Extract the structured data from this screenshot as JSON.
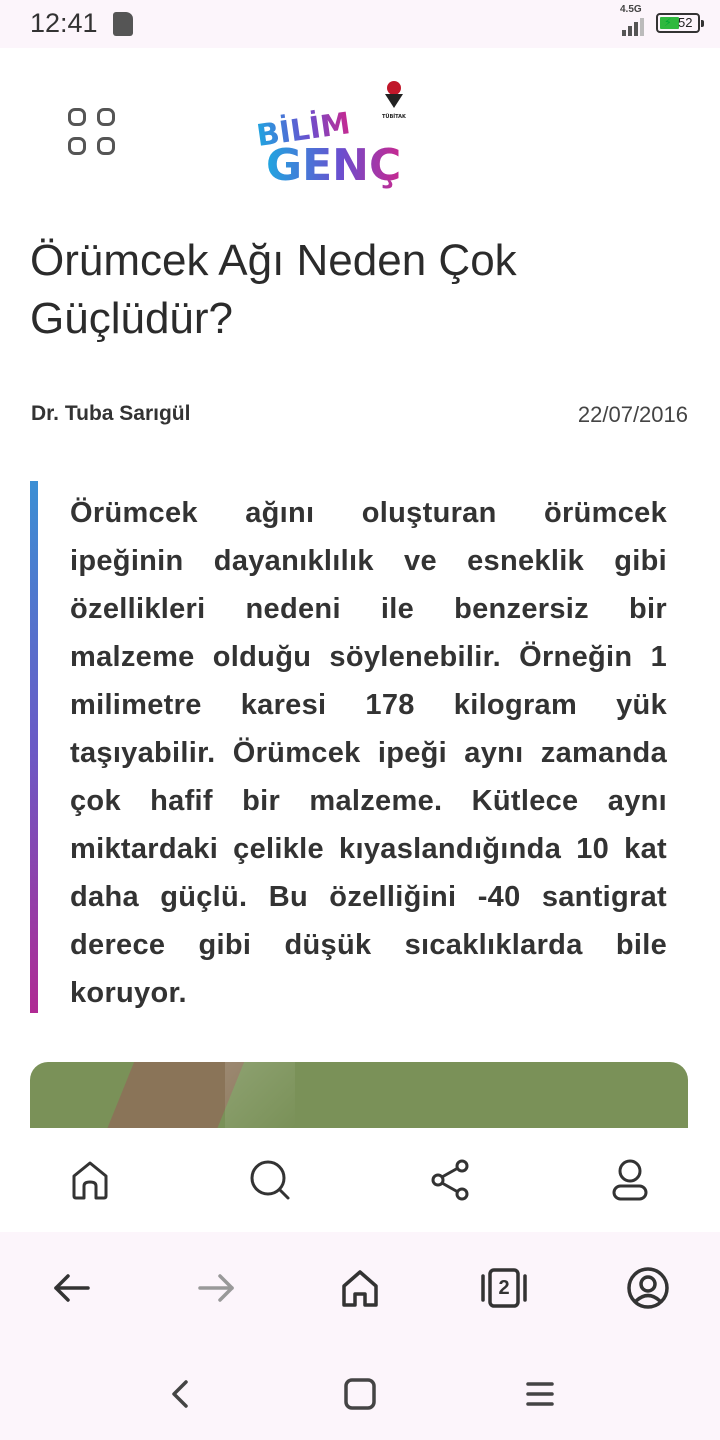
{
  "status_bar": {
    "time": "12:41",
    "network": "4.5G",
    "battery": "52"
  },
  "header": {
    "logo_line1": "BİLİM",
    "logo_line2": "GENÇ",
    "logo_badge": "TÜBİTAK"
  },
  "article": {
    "title": "Örümcek Ağı Neden Çok Güçlüdür?",
    "author": "Dr. Tuba Sarıgül",
    "date": "22/07/2016",
    "summary": "Örümcek ağını oluşturan örümcek ipeğinin dayanıklılık ve esneklik gibi özellikleri nedeni ile benzersiz bir malzeme olduğu söylenebilir. Örneğin 1 milimetre karesi 178 kilogram yük taşıyabilir. Örümcek ipeği aynı zamanda çok hafif bir malzeme. Kütlece aynı miktardaki çelikle kıyaslandığında 10 kat daha güçlü. Bu özelliğini -40 santigrat derece gibi düşük sıcaklıklarda bile koruyor."
  },
  "browser": {
    "tab_count": "2"
  },
  "colors": {
    "accent_blue": "#3b8fd4",
    "accent_purple": "#b02a93",
    "status_bg": "#fcf5fb",
    "battery_green": "#2fb83e"
  },
  "icons": {
    "app_nav": [
      "home-icon",
      "search-icon",
      "share-icon",
      "user-icon"
    ],
    "browser_nav": [
      "back-arrow-icon",
      "forward-arrow-icon",
      "home-icon",
      "tabs-icon",
      "account-icon"
    ],
    "system_nav": [
      "back-chevron-icon",
      "recent-apps-icon",
      "menu-icon"
    ]
  }
}
